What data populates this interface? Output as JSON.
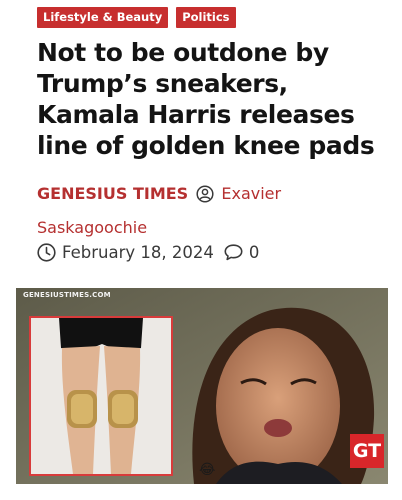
{
  "tags": [
    "Lifestyle & Beauty",
    "Politics"
  ],
  "headline": "Not to be outdone by Trump’s sneakers, Kamala Harris releases line of golden knee pads",
  "byline": {
    "publisher": "GENESIUS TIMES",
    "author": "Exavier Saskagoochie",
    "author_icon": "user-circle-icon"
  },
  "meta": {
    "date": "February 18, 2024",
    "date_icon": "clock-icon",
    "comment_icon": "comment-icon",
    "comment_count": "0"
  },
  "hero": {
    "watermark": "GENESIUSTIMES.COM",
    "badge": "GT",
    "emoji": "😂"
  },
  "colors": {
    "tag_bg": "#c72f2f",
    "byline": "#b53030",
    "gt_badge": "#d8262a",
    "inset_border": "#d83b3b"
  }
}
